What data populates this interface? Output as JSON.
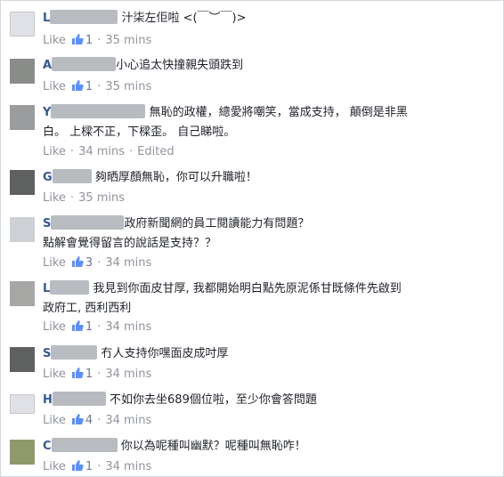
{
  "comments": [
    {
      "name_visible": "L",
      "text1": "汁柒左佢啦 <(￣︶￣)>",
      "text2": "",
      "like": "Like",
      "likes": "1",
      "time": "35 mins",
      "edited": ""
    },
    {
      "name_visible": "A",
      "text1": "小心追太快撞親失頭跌到",
      "text2": "",
      "like": "Like",
      "likes": "1",
      "time": "35 mins",
      "edited": ""
    },
    {
      "name_visible": "Y",
      "text1": "無恥的政權，總愛將嘲笑，當成支持，  顛倒是非黑",
      "text2": "白。 上樑不正，下樑歪。 自己睇啦。",
      "like": "Like",
      "likes": "",
      "time": "34 mins",
      "edited": "Edited"
    },
    {
      "name_visible": "G",
      "text1": "夠晒厚顏無恥，你可以升職啦！",
      "text2": "",
      "like": "Like",
      "likes": "",
      "time": "35 mins",
      "edited": ""
    },
    {
      "name_visible": "S",
      "text1": "政府新聞網的員工閱讀能力有問題？",
      "text2": "點解會覺得留言的說話是支持？？",
      "like": "Like",
      "likes": "3",
      "time": "34 mins",
      "edited": ""
    },
    {
      "name_visible": "L",
      "text1": "我見到你面皮甘厚, 我都開始明白點先原泥係甘既條件先啟到",
      "text2": "政府工, 西利西利",
      "like": "Like",
      "likes": "1",
      "time": "34 mins",
      "edited": ""
    },
    {
      "name_visible": "S",
      "text1": "冇人支持你嘿面皮成吋厚",
      "text2": "",
      "like": "Like",
      "likes": "1",
      "time": "34 mins",
      "edited": ""
    },
    {
      "name_visible": "H",
      "text1": "不如你去坐689個位啦，至少你會答問題",
      "text2": "",
      "like": "Like",
      "likes": "4",
      "time": "34 mins",
      "edited": ""
    },
    {
      "name_visible": "C",
      "text1": "你以為呢種叫幽默？呢種叫無恥咋！",
      "text2": "",
      "like": "Like",
      "likes": "1",
      "time": "34 mins",
      "edited": ""
    }
  ],
  "icons": {
    "like": "thumbs-up-icon"
  },
  "colors": {
    "name": "#365899",
    "meta": "#90949c",
    "thumb": "#5890ff"
  }
}
